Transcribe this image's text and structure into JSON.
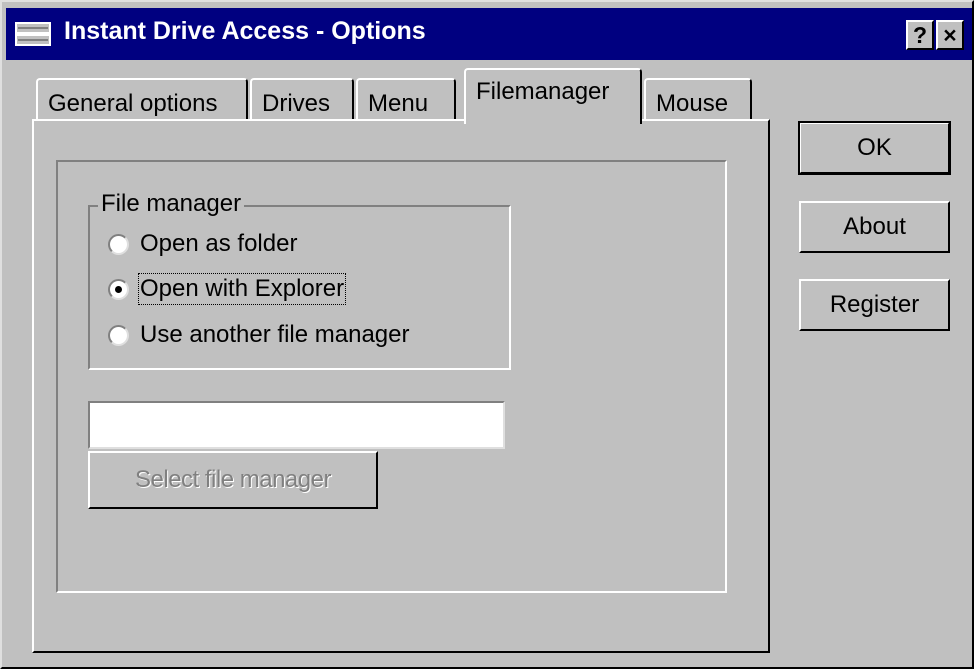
{
  "window": {
    "title": "Instant Drive Access - Options",
    "help_button": "?",
    "close_button": "×"
  },
  "tabs": [
    {
      "label": "General options",
      "active": false
    },
    {
      "label": "Drives",
      "active": false
    },
    {
      "label": "Menu",
      "active": false
    },
    {
      "label": "Filemanager",
      "active": true
    },
    {
      "label": "Mouse",
      "active": false
    }
  ],
  "file_manager": {
    "group_label": "File manager",
    "options": [
      {
        "label": "Open as folder",
        "selected": false
      },
      {
        "label": "Open with Explorer",
        "selected": true
      },
      {
        "label": "Use another file manager",
        "selected": false
      }
    ],
    "path_value": "",
    "select_button": "Select file manager",
    "select_button_enabled": false
  },
  "buttons": {
    "ok": "OK",
    "about": "About",
    "register": "Register"
  },
  "icons": {
    "title": "drive-icon",
    "help": "help-icon",
    "close": "close-icon"
  }
}
